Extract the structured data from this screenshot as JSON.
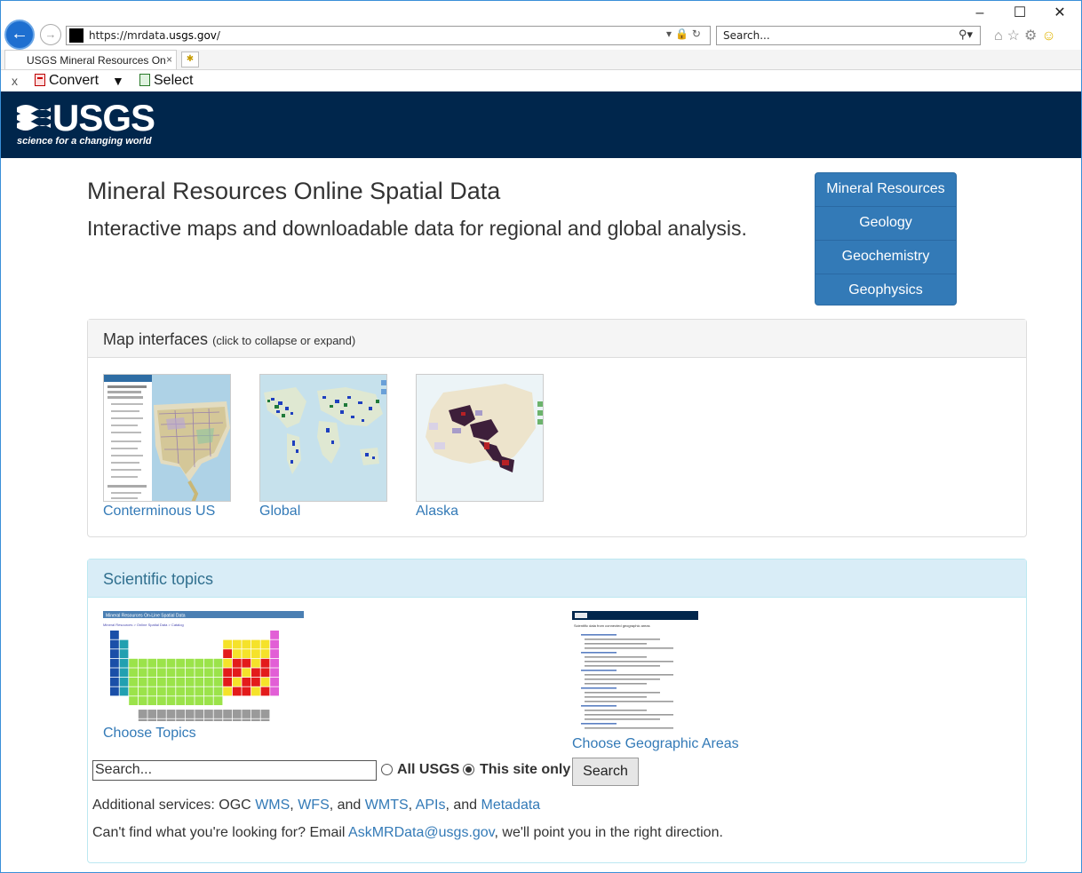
{
  "browser": {
    "url_prefix": "https://mrdata.",
    "url_domain": "usgs.gov",
    "url_suffix": "/",
    "search_placeholder": "Search...",
    "tab_title": "USGS Mineral Resources On...",
    "tab_close": "×",
    "cmd_close": "x",
    "convert_label": "Convert",
    "select_label": "Select",
    "window_minimize": "–",
    "window_maximize": "☐",
    "window_close": "✕"
  },
  "header": {
    "logo_text": "USGS",
    "logo_tagline": "science for a changing world"
  },
  "page": {
    "title": "Mineral Resources Online Spatial Data",
    "subtitle": "Interactive maps and downloadable data for regional and global analysis."
  },
  "nav": {
    "items": [
      {
        "label": "Mineral Resources"
      },
      {
        "label": "Geology"
      },
      {
        "label": "Geochemistry"
      },
      {
        "label": "Geophysics"
      }
    ]
  },
  "map_panel": {
    "heading": "Map interfaces",
    "hint": "(click to collapse or expand)",
    "items": [
      {
        "label": "Conterminous US"
      },
      {
        "label": "Global"
      },
      {
        "label": "Alaska"
      }
    ]
  },
  "topics_panel": {
    "heading": "Scientific topics",
    "topics_label": "Choose Topics",
    "geo_label": "Choose Geographic Areas",
    "periodic_title": "Mineral Resources On-Line Spatial Data",
    "periodic_crumbs": "Mineral Resources > Online Spatial Data > Catalog",
    "geo_thumb_title": "Scientific data from connected geographic areas"
  },
  "search": {
    "placeholder": "Search...",
    "option_all": "All USGS",
    "option_site": "This site only",
    "button": "Search"
  },
  "services": {
    "prefix": "Additional services: OGC ",
    "wms": "WMS",
    "sep1": ", ",
    "wfs": "WFS",
    "sep2": ", and ",
    "wmts": "WMTS",
    "sep3": ", ",
    "apis": "APIs",
    "sep4": ", and ",
    "metadata": "Metadata"
  },
  "help": {
    "prefix": "Can't find what you're looking for? Email ",
    "email": "AskMRData@usgs.gov",
    "suffix": ", we'll point you in the right direction."
  },
  "colors": {
    "banner": "#00264c",
    "nav": "#337ab7",
    "link": "#337ab7",
    "info_head": "#d9edf7"
  }
}
